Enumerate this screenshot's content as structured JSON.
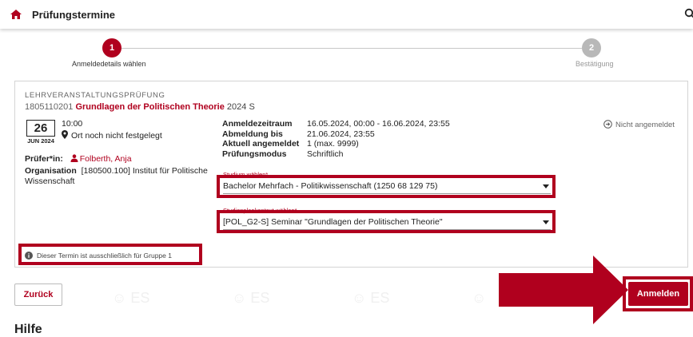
{
  "header": {
    "title": "Prüfungstermine"
  },
  "stepper": {
    "steps": [
      {
        "number": "1",
        "label": "Anmeldedetails wählen"
      },
      {
        "number": "2",
        "label": "Bestätigung"
      }
    ]
  },
  "exam": {
    "type": "LEHRVERANSTALTUNGSPRÜFUNG",
    "code": "1805110201",
    "course_name": "Grundlagen der Politischen Theorie",
    "term": "2024 S",
    "date_day": "26",
    "date_month": "JUN 2024",
    "time": "10:00",
    "location": "Ort noch nicht festgelegt",
    "examiner_label": "Prüfer*in:",
    "examiner_name": "Folberth, Anja",
    "organisation_label": "Organisation",
    "organisation_value": "[180500.100] Institut für Politische Wissenschaft",
    "details": [
      {
        "key": "Anmeldezeitraum",
        "value": "16.05.2024, 00:00 - 16.06.2024, 23:55"
      },
      {
        "key": "Abmeldung bis",
        "value": "21.06.2024, 23:55"
      },
      {
        "key": "Aktuell angemeldet",
        "value": "1 (max. 9999)"
      },
      {
        "key": "Prüfungsmodus",
        "value": "Schriftlich"
      }
    ],
    "status": "Nicht angemeldet",
    "study_label": "Studium wählen*",
    "study_value": "Bachelor Mehrfach - Politikwissenschaft (1250 68 129 75)",
    "context_label": "Studienplankontext wählen*",
    "context_value": "[POL_G2-S]  Seminar \"Grundlagen der Politischen Theorie\"",
    "info_note": "Dieser Termin ist ausschließlich für Gruppe 1"
  },
  "actions": {
    "back_label": "Zurück",
    "register_label": "Anmelden"
  },
  "footer": {
    "cut_text": "Hilfe"
  },
  "colors": {
    "accent": "#b0001e",
    "inactive_step": "#b8b8b8"
  },
  "icons": [
    "home-icon",
    "search-icon",
    "location-pin-icon",
    "person-icon",
    "arrow-right-circle-icon",
    "info-icon",
    "chevron-down-icon",
    "arrow-annotation"
  ]
}
